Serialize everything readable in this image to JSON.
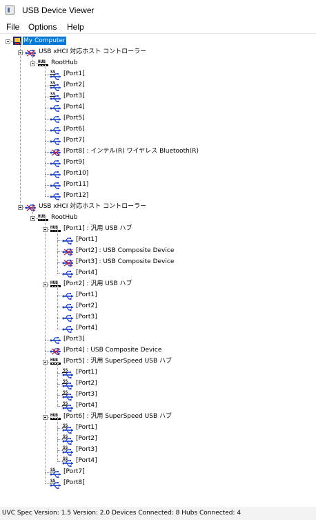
{
  "window": {
    "title": "USB Device Viewer",
    "icon": "app-window-icon"
  },
  "menu": {
    "items": [
      "File",
      "Options",
      "Help"
    ]
  },
  "tree": {
    "root": "My Computer",
    "controllers": [
      {
        "label": "USB xHCI 対応ホスト コントローラー",
        "roothub": "RootHub",
        "ports": [
          {
            "label": "[Port1]",
            "icon": "superspeed-usb-icon"
          },
          {
            "label": "[Port2]",
            "icon": "superspeed-usb-icon"
          },
          {
            "label": "[Port3]",
            "icon": "superspeed-usb-icon"
          },
          {
            "label": "[Port4]",
            "icon": "usb-port-icon"
          },
          {
            "label": "[Port5]",
            "icon": "usb-port-icon"
          },
          {
            "label": "[Port6]",
            "icon": "usb-port-icon"
          },
          {
            "label": "[Port7]",
            "icon": "usb-port-icon"
          },
          {
            "label": "[Port8] : インテル(R) ワイヤレス Bluetooth(R)",
            "icon": "usb-device-icon"
          },
          {
            "label": "[Port9]",
            "icon": "usb-port-icon"
          },
          {
            "label": "[Port10]",
            "icon": "usb-port-icon"
          },
          {
            "label": "[Port11]",
            "icon": "usb-port-icon"
          },
          {
            "label": "[Port12]",
            "icon": "usb-port-icon"
          }
        ]
      },
      {
        "label": "USB xHCI 対応ホスト コントローラー",
        "roothub": "RootHub",
        "ports": [
          {
            "label": "[Port1] : 汎用 USB ハブ",
            "icon": "hub-icon",
            "children": [
              {
                "label": "[Port1]",
                "icon": "usb-port-icon"
              },
              {
                "label": "[Port2] : USB Composite Device",
                "icon": "usb-device-icon"
              },
              {
                "label": "[Port3] : USB Composite Device",
                "icon": "usb-device-icon"
              },
              {
                "label": "[Port4]",
                "icon": "usb-port-icon"
              }
            ]
          },
          {
            "label": "[Port2] : 汎用 USB ハブ",
            "icon": "hub-icon",
            "children": [
              {
                "label": "[Port1]",
                "icon": "usb-port-icon"
              },
              {
                "label": "[Port2]",
                "icon": "usb-port-icon"
              },
              {
                "label": "[Port3]",
                "icon": "usb-port-icon"
              },
              {
                "label": "[Port4]",
                "icon": "usb-port-icon"
              }
            ]
          },
          {
            "label": "[Port3]",
            "icon": "usb-port-icon"
          },
          {
            "label": "[Port4] : USB Composite Device",
            "icon": "usb-device-icon"
          },
          {
            "label": "[Port5] : 汎用 SuperSpeed USB ハブ",
            "icon": "hub-icon",
            "children": [
              {
                "label": "[Port1]",
                "icon": "superspeed-usb-icon"
              },
              {
                "label": "[Port2]",
                "icon": "superspeed-usb-icon"
              },
              {
                "label": "[Port3]",
                "icon": "superspeed-usb-icon"
              },
              {
                "label": "[Port4]",
                "icon": "superspeed-usb-icon"
              }
            ]
          },
          {
            "label": "[Port6] : 汎用 SuperSpeed USB ハブ",
            "icon": "hub-icon",
            "children": [
              {
                "label": "[Port1]",
                "icon": "superspeed-usb-icon"
              },
              {
                "label": "[Port2]",
                "icon": "superspeed-usb-icon"
              },
              {
                "label": "[Port3]",
                "icon": "superspeed-usb-icon"
              },
              {
                "label": "[Port4]",
                "icon": "superspeed-usb-icon"
              }
            ]
          },
          {
            "label": "[Port7]",
            "icon": "superspeed-usb-icon"
          },
          {
            "label": "[Port8]",
            "icon": "superspeed-usb-icon"
          }
        ]
      }
    ]
  },
  "status": {
    "text": "UVC Spec Version: 1.5  Version: 2.0 Devices Connected: 8   Hubs Connected: 4"
  },
  "colors": {
    "selection": "#0078d7",
    "usb_blue": "#1a3fd0",
    "device_red": "#c8102e"
  }
}
